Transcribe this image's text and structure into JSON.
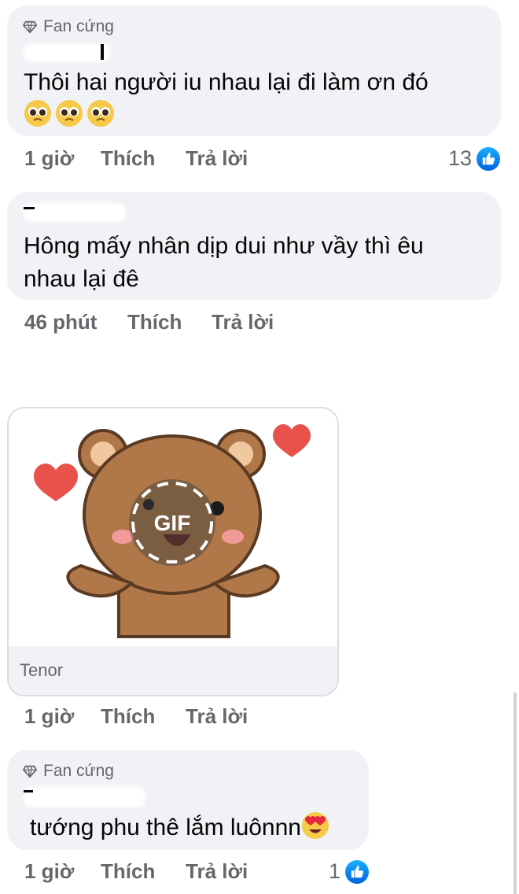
{
  "comments": [
    {
      "badge": "Fan cứng",
      "text_line1": "Thôi hai người iu nhau lại đi làm ơn đó",
      "emoji": "pleading-face",
      "time": "1 giờ",
      "like_label": "Thích",
      "reply_label": "Trả lời",
      "reactions": "13"
    },
    {
      "text_line1": "Hông mấy nhân dịp dui như vầy thì êu",
      "text_line2": "nhau lại đê",
      "time": "46 phút",
      "like_label": "Thích",
      "reply_label": "Trả lời"
    },
    {
      "gif_provider": "Tenor",
      "gif_label": "GIF",
      "time": "1 giờ",
      "like_label": "Thích",
      "reply_label": "Trả lời"
    },
    {
      "badge": "Fan cứng",
      "text_line1": "tướng phu thê lắm luônnn",
      "emoji": "heart-eyes",
      "time": "1 giờ",
      "like_label": "Thích",
      "reply_label": "Trả lời",
      "reactions": "1"
    }
  ],
  "colors": {
    "bubble": "#f0f2f5",
    "meta_text": "#65676b",
    "like_blue": "#1877f2",
    "bear_brown": "#b07848",
    "heart_red": "#e8524a"
  }
}
